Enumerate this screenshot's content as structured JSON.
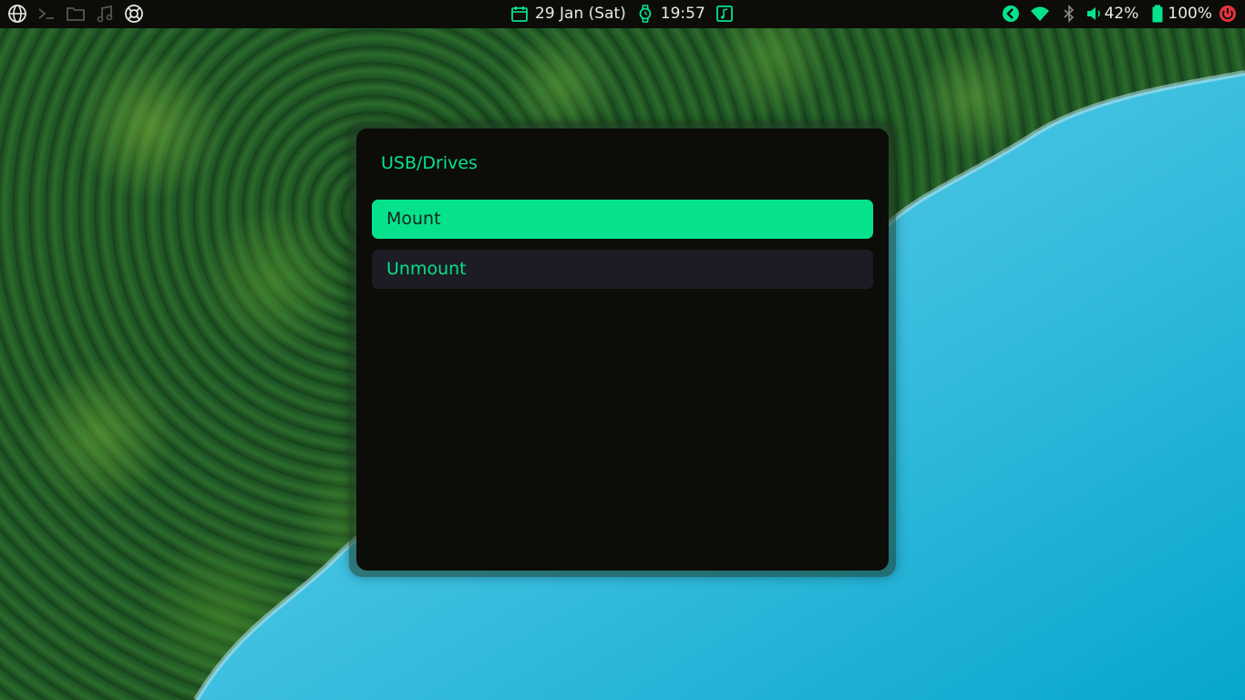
{
  "topbar": {
    "date": "29 Jan (Sat)",
    "time": "19:57",
    "volume": "42%",
    "battery": "100%",
    "left_icons": [
      "globe-icon",
      "terminal-icon",
      "folder-icon",
      "music-icon",
      "lifebuoy-icon"
    ],
    "center_icons": [
      "calendar-icon",
      "watch-icon",
      "music-note-icon"
    ],
    "right_icons": [
      "back-arrow-icon",
      "wifi-icon",
      "bluetooth-icon",
      "volume-icon",
      "battery-icon",
      "power-icon"
    ]
  },
  "dialog": {
    "title": "USB/Drives",
    "options": [
      {
        "label": "Mount",
        "selected": true
      },
      {
        "label": "Unmount",
        "selected": false
      }
    ]
  },
  "colors": {
    "accent": "#06e28c",
    "bar_bg": "#0c0c09",
    "dialog_bg": "#0c0c09",
    "option_bg": "#1c1c24",
    "power_red": "#e0343d",
    "lake_blue": "#2bb5d8"
  }
}
